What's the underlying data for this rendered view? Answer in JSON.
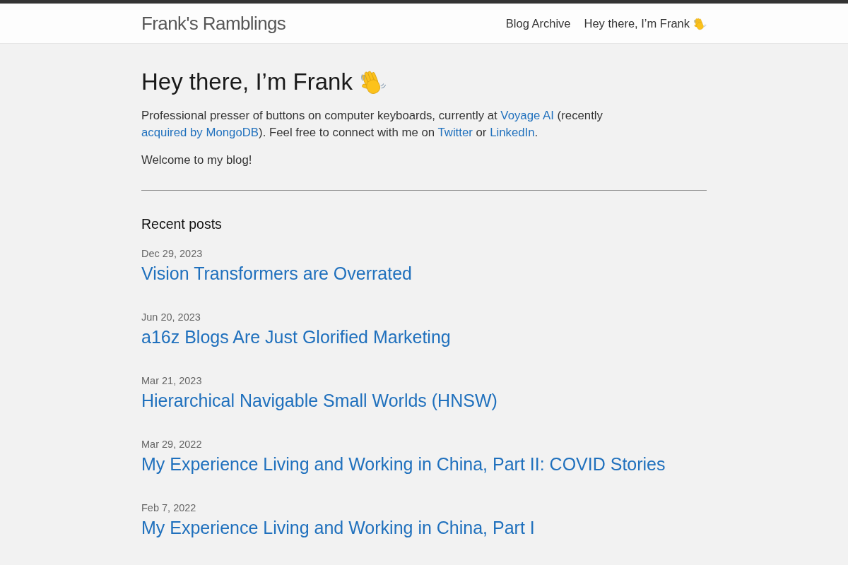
{
  "header": {
    "site_title": "Frank's Ramblings",
    "nav": [
      {
        "label": "Blog Archive",
        "icon": false
      },
      {
        "label": "Hey there, I’m Frank",
        "icon": true
      }
    ]
  },
  "intro": {
    "heading": "Hey there, I’m Frank",
    "paragraphs": [
      [
        {
          "kind": "text",
          "text": "Professional presser of buttons on computer keyboards, currently at "
        },
        {
          "kind": "link",
          "text": "Voyage AI"
        },
        {
          "kind": "text",
          "text": " (recently "
        },
        {
          "kind": "link",
          "text": "acquired by MongoDB"
        },
        {
          "kind": "text",
          "text": "). Feel free to connect with me on "
        },
        {
          "kind": "link",
          "text": "Twitter"
        },
        {
          "kind": "text",
          "text": " or "
        },
        {
          "kind": "link",
          "text": "LinkedIn"
        },
        {
          "kind": "text",
          "text": "."
        }
      ],
      [
        {
          "kind": "text",
          "text": "Welcome to my blog!"
        }
      ]
    ]
  },
  "recent_posts": {
    "title": "Recent posts",
    "posts": [
      {
        "date": "Dec 29, 2023",
        "title": "Vision Transformers are Overrated"
      },
      {
        "date": "Jun 20, 2023",
        "title": "a16z Blogs Are Just Glorified Marketing"
      },
      {
        "date": "Mar 21, 2023",
        "title": "Hierarchical Navigable Small Worlds (HNSW)"
      },
      {
        "date": "Mar 29, 2022",
        "title": "My Experience Living and Working in China, Part II: COVID Stories"
      },
      {
        "date": "Feb 7, 2022",
        "title": "My Experience Living and Working in China, Part I"
      }
    ]
  }
}
